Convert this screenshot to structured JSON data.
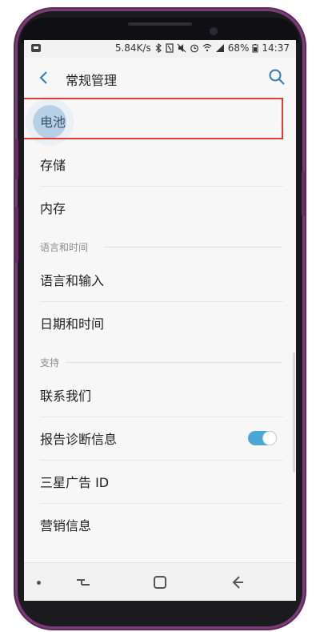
{
  "status": {
    "speed": "5.84K/s",
    "battery": "68%",
    "time": "14:37"
  },
  "header": {
    "title": "常规管理"
  },
  "items": {
    "battery": "电池",
    "storage": "存储",
    "memory": "内存",
    "language_input": "语言和输入",
    "date_time": "日期和时间",
    "contact_us": "联系我们",
    "report_diagnostics": "报告诊断信息",
    "samsung_ad_id": "三星广告 ID",
    "marketing_info": "营销信息"
  },
  "sections": {
    "language_time": "语言和时间",
    "support": "支持"
  },
  "toggles": {
    "report_diagnostics": "on"
  },
  "icons": {
    "status_left": "notification-icon",
    "bluetooth": "bluetooth-icon",
    "nfc": "nfc-icon",
    "mute": "mute-icon",
    "alarm": "alarm-icon",
    "wifi": "wifi-icon",
    "signal": "signal-icon",
    "battery": "battery-icon",
    "back": "back-icon",
    "search": "search-icon",
    "nav_recents": "recents-icon",
    "nav_home": "home-icon",
    "nav_back": "nav-back-icon"
  },
  "colors": {
    "accent_toggle": "#4aa7d6",
    "highlight_box": "#e53935",
    "phone_frame": "#7b3b78"
  }
}
